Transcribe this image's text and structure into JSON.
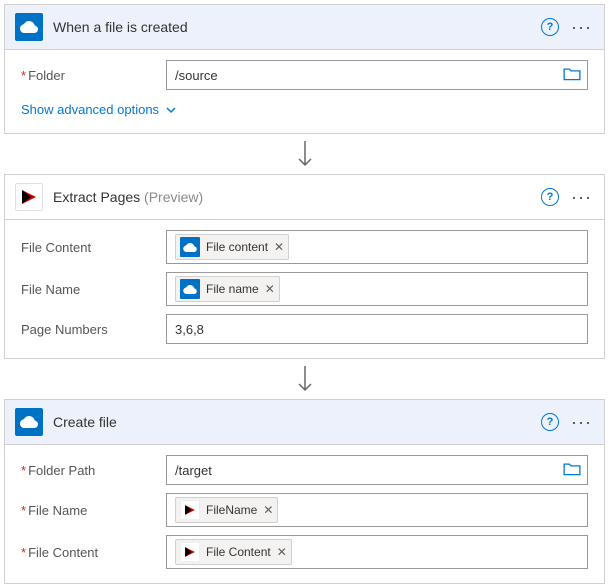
{
  "colors": {
    "accent": "#0078d4",
    "onedrive": "#0072c6",
    "required": "#c62828"
  },
  "card1": {
    "title": "When a file is created",
    "folderLabel": "Folder",
    "folderValue": "/source",
    "advanced": "Show advanced options"
  },
  "card2": {
    "title": "Extract Pages",
    "preview": "(Preview)",
    "rows": {
      "fileContentLabel": "File Content",
      "fileContentToken": "File content",
      "fileNameLabel": "File Name",
      "fileNameToken": "File name",
      "pageNumbersLabel": "Page Numbers",
      "pageNumbersValue": "3,6,8"
    }
  },
  "card3": {
    "title": "Create file",
    "rows": {
      "folderPathLabel": "Folder Path",
      "folderPathValue": "/target",
      "fileNameLabel": "File Name",
      "fileNameToken": "FileName",
      "fileContentLabel": "File Content",
      "fileContentToken": "File Content"
    }
  }
}
